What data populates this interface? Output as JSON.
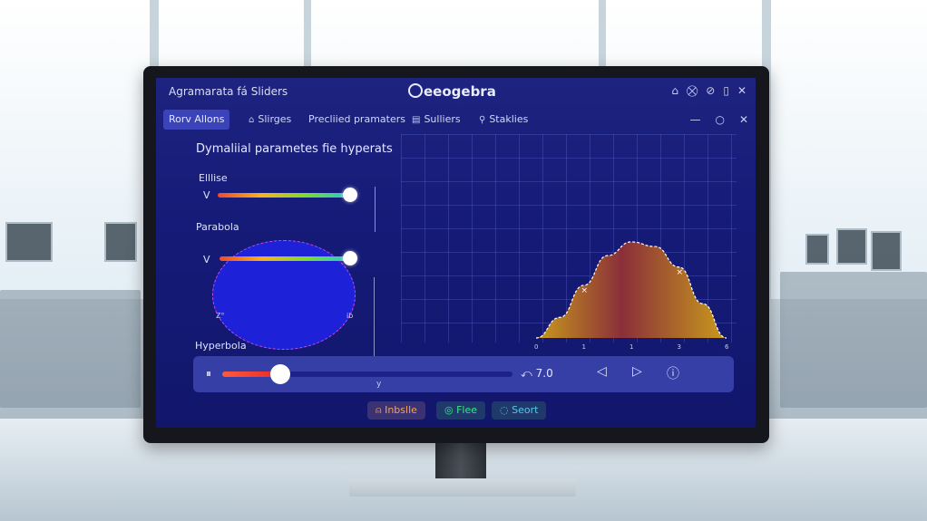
{
  "window": {
    "title": "Agramarata fá Sliders",
    "brand_mark": "G",
    "brand_rest": "eeogebra",
    "title_icons": [
      "⌂",
      "⛒",
      "⊘",
      "▯",
      "✕"
    ]
  },
  "toolbar": {
    "tabs": [
      {
        "label": "Rorv Allons",
        "icon": "",
        "active": true
      },
      {
        "label": "Slirges",
        "icon": "⌂",
        "active": false
      },
      {
        "label": "Precliied pramaters",
        "icon": "",
        "active": false
      },
      {
        "label": "Sulliers",
        "icon": "▤",
        "active": false
      },
      {
        "label": "Staklies",
        "icon": "⚲",
        "active": false
      }
    ],
    "window_controls": [
      "—",
      "○",
      "✕"
    ]
  },
  "panel": {
    "heading": "Dymaliial parametes fie hyperats",
    "ellipse_label": "Elllise",
    "parabola_label": "Parabola",
    "hyperbola_label": "Hyperbola",
    "slider_v_label": "V",
    "ellipse_slider_level": 1.0,
    "parabola_slider_level": 1.0,
    "ellipse_axis_labels": {
      "left": "Z°",
      "right": "ib"
    }
  },
  "chart_data": {
    "type": "area",
    "x": [
      0,
      1,
      2,
      3,
      4,
      5,
      6,
      7,
      8
    ],
    "values": [
      0,
      0.9,
      2.3,
      3.6,
      4.2,
      4.0,
      3.1,
      1.5,
      0
    ],
    "xtick_labels": [
      "0",
      "1",
      "1",
      "3",
      "6"
    ],
    "marked_points": [
      "×",
      "×"
    ],
    "fill_colors": [
      "#c99a1c",
      "#8a2f3a"
    ]
  },
  "player": {
    "pause_icon": "⏸",
    "position": 0.2,
    "time_text": "⤺ 7.0",
    "prev_icon": "◁",
    "next_icon": "▷",
    "info_icon": "ⓘ",
    "cursor_label": "y"
  },
  "buttons": {
    "inline": "⍝ Inbslle",
    "flee": "◎ Flee",
    "sort": "◌ Seort"
  }
}
